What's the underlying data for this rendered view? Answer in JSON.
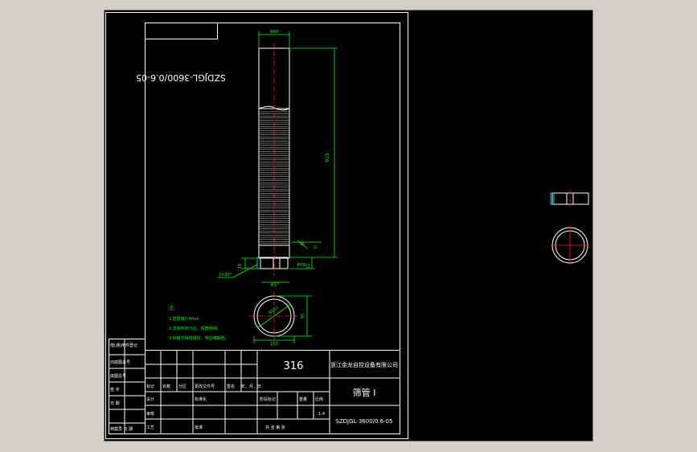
{
  "drawing": {
    "rotated_code": "SZDJGL-3600/0.6-05",
    "dim_top_width": "Φ80",
    "dim_height": "913",
    "dim_base_height": "15",
    "dim_base_width": "Φ78",
    "dim_chamfer": "2×30°",
    "dim_angle": "45°",
    "dim_thread": "M",
    "dim_small": "18",
    "dim_side": "G",
    "section_diameter": "Φ103",
    "section_width": "103",
    "section_height": "95",
    "notes_title": "注:",
    "notes": [
      "1.壁厚度0.4mm",
      "2.去除毛刺飞边、锐角倒钝。",
      "3.焊缝不得有裂纹、咬边等缺陷。"
    ]
  },
  "title_block": {
    "material": "316",
    "company": "浙江金龙自控设备有限公司",
    "part_name": "筛管 I",
    "drawing_number": "SZDJGL-3600/0.6-05",
    "scale": "1:4",
    "rev_mark_label": "标记",
    "rev_count_label": "处数",
    "rev_zone_label": "分区",
    "rev_docno_label": "更改文件号",
    "rev_sign_label": "签名",
    "rev_date_label": "年、月、日",
    "design_label": "设计",
    "standard_label": "标准化",
    "check_label": "审核",
    "process_label": "工艺",
    "approve_label": "批准",
    "stage_label": "阶段标记",
    "weight_label": "重量",
    "scale_label": "比例",
    "sheet_label": "共  张  第  张"
  },
  "side_panel": {
    "used_in": "借(通)用件登记",
    "trace": "旧底图总号",
    "base_no": "底图总号",
    "sign": "签  字",
    "date": "日  期",
    "archive": "档案员  日  期"
  }
}
